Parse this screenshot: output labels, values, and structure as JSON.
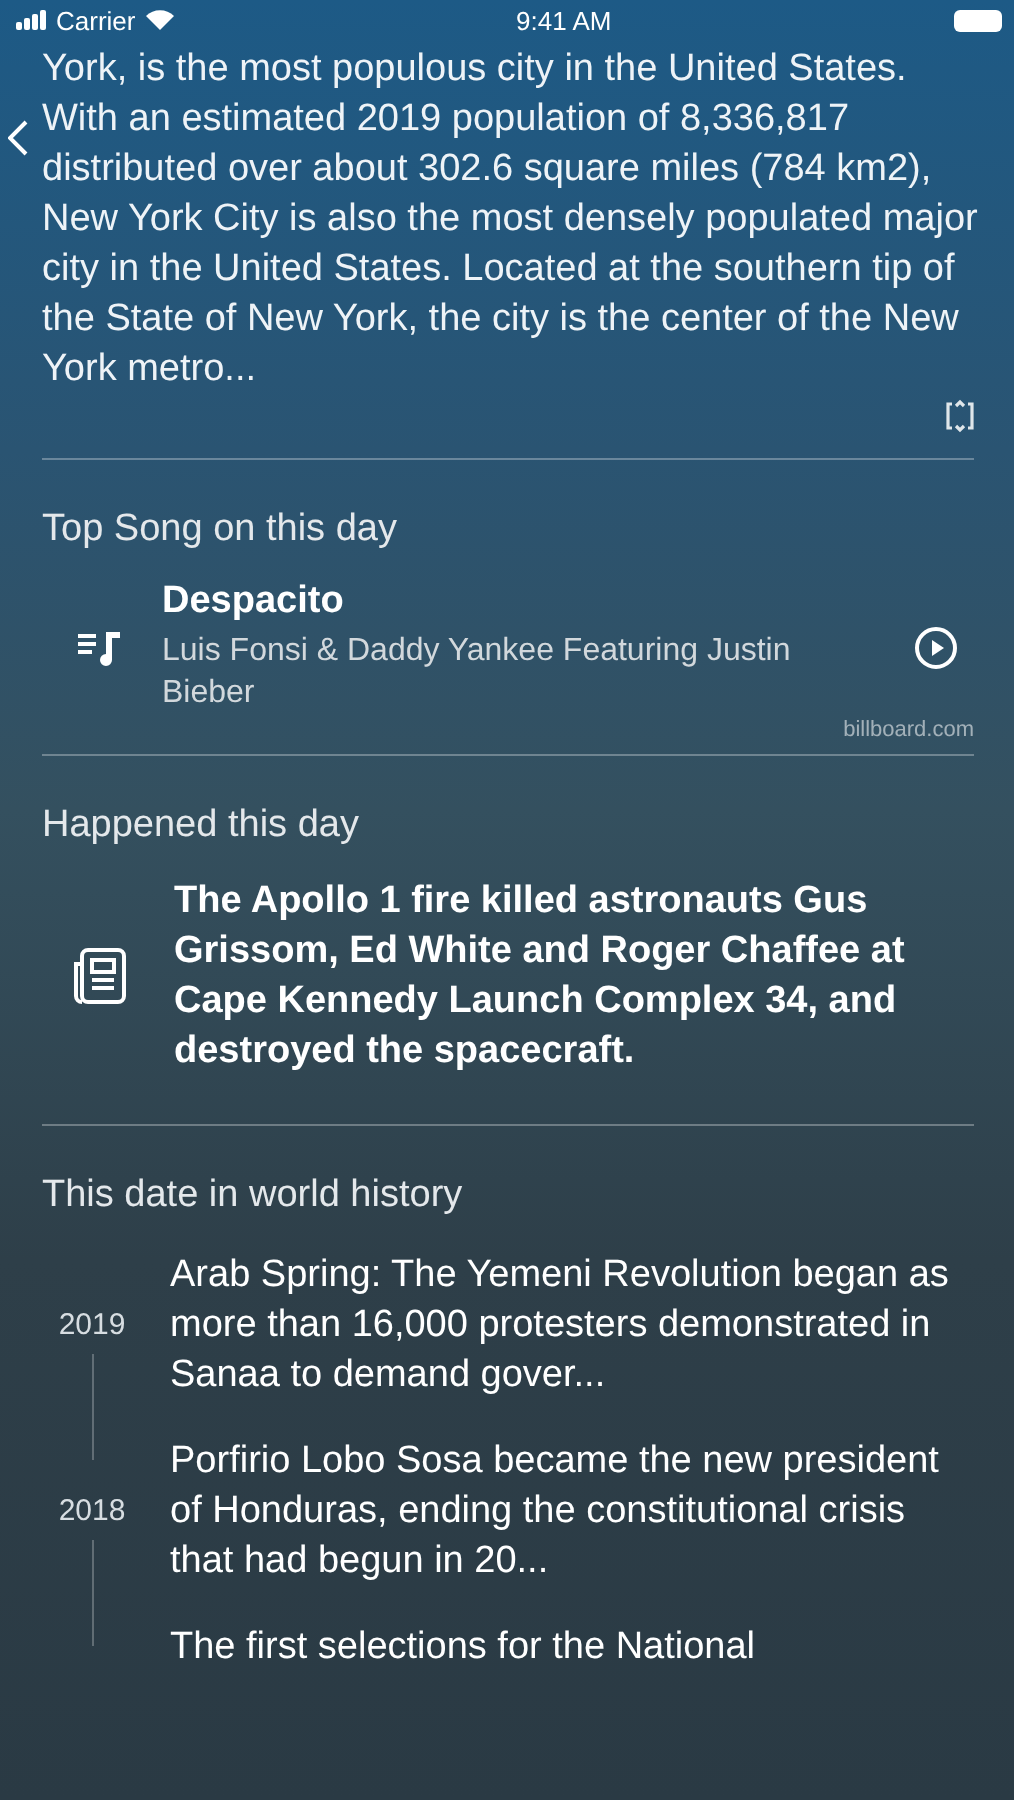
{
  "status_bar": {
    "carrier": "Carrier",
    "time": "9:41 AM"
  },
  "summary": {
    "text": "York, is the most populous city in the United States. With an estimated 2019 population of 8,336,817 distributed over about 302.6 square miles (784 km2), New York City is also the most densely populated major city in the United States. Located at the southern tip of the State of New York, the city is the center of the New York metro..."
  },
  "top_song": {
    "heading": "Top Song on this day",
    "title": "Despacito",
    "artist": "Luis Fonsi & Daddy Yankee Featuring Justin Bieber",
    "source": "billboard.com"
  },
  "happened": {
    "heading": "Happened this day",
    "text": "The Apollo 1 fire killed astronauts Gus Grissom, Ed White and Roger Chaffee at Cape Kennedy Launch Complex 34, and destroyed the spacecraft."
  },
  "history": {
    "heading": "This date in world history",
    "items": [
      {
        "year": "2019",
        "text": "Arab Spring: The Yemeni Revolution began as more than 16,000 protesters demonstrated in Sanaa to demand gover..."
      },
      {
        "year": "2018",
        "text": "Porfirio Lobo Sosa became the new president of Honduras, ending the constitutional crisis that had begun in 20..."
      },
      {
        "text": "The first selections for the National"
      }
    ]
  }
}
